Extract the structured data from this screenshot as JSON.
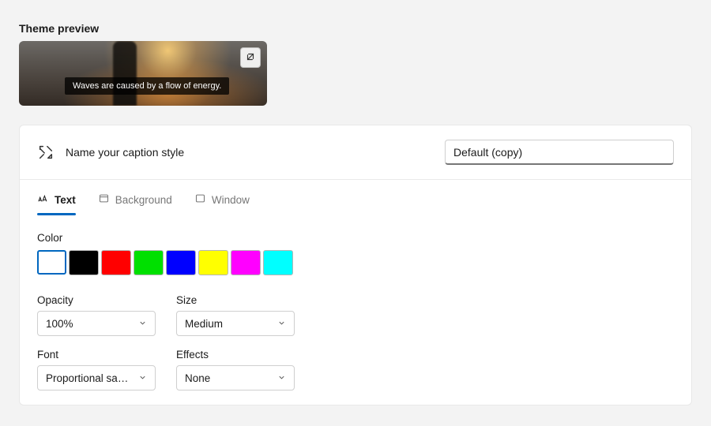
{
  "preview": {
    "title": "Theme preview",
    "caption_text": "Waves are caused by a flow of energy."
  },
  "style_name": {
    "label": "Name your caption style",
    "value": "Default (copy)"
  },
  "tabs": [
    {
      "id": "text",
      "label": "Text",
      "active": true
    },
    {
      "id": "background",
      "label": "Background",
      "active": false
    },
    {
      "id": "window",
      "label": "Window",
      "active": false
    }
  ],
  "color": {
    "label": "Color",
    "swatches": [
      "#ffffff",
      "#000000",
      "#ff0000",
      "#00e000",
      "#0000ff",
      "#ffff00",
      "#ff00ff",
      "#00ffff"
    ],
    "selected_index": 0
  },
  "fields": {
    "opacity": {
      "label": "Opacity",
      "value": "100%"
    },
    "size": {
      "label": "Size",
      "value": "Medium"
    },
    "font": {
      "label": "Font",
      "value": "Proportional sans s..."
    },
    "effects": {
      "label": "Effects",
      "value": "None"
    }
  }
}
